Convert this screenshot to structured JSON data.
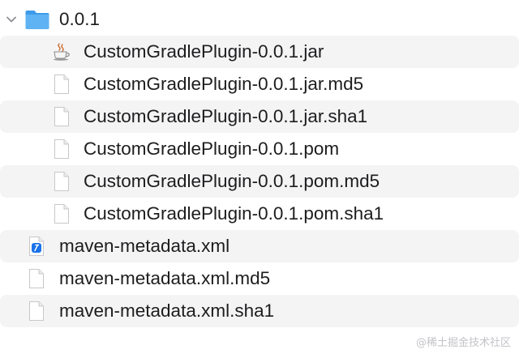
{
  "folder": {
    "name": "0.0.1",
    "expanded": true,
    "icon": "folder-icon",
    "color": "#3d9be9"
  },
  "folder_children": [
    {
      "name": "CustomGradlePlugin-0.0.1.jar",
      "icon": "java-jar-icon"
    },
    {
      "name": "CustomGradlePlugin-0.0.1.jar.md5",
      "icon": "document-icon"
    },
    {
      "name": "CustomGradlePlugin-0.0.1.jar.sha1",
      "icon": "document-icon"
    },
    {
      "name": "CustomGradlePlugin-0.0.1.pom",
      "icon": "document-icon"
    },
    {
      "name": "CustomGradlePlugin-0.0.1.pom.md5",
      "icon": "document-icon"
    },
    {
      "name": "CustomGradlePlugin-0.0.1.pom.sha1",
      "icon": "document-icon"
    }
  ],
  "files": [
    {
      "name": "maven-metadata.xml",
      "icon": "xcode-xml-icon"
    },
    {
      "name": "maven-metadata.xml.md5",
      "icon": "document-icon"
    },
    {
      "name": "maven-metadata.xml.sha1",
      "icon": "document-icon"
    }
  ],
  "watermark": "@稀土掘金技术社区",
  "colors": {
    "row_alt": "#f4f4f5",
    "text": "#1d1d1f",
    "accent": "#1a73e8"
  }
}
